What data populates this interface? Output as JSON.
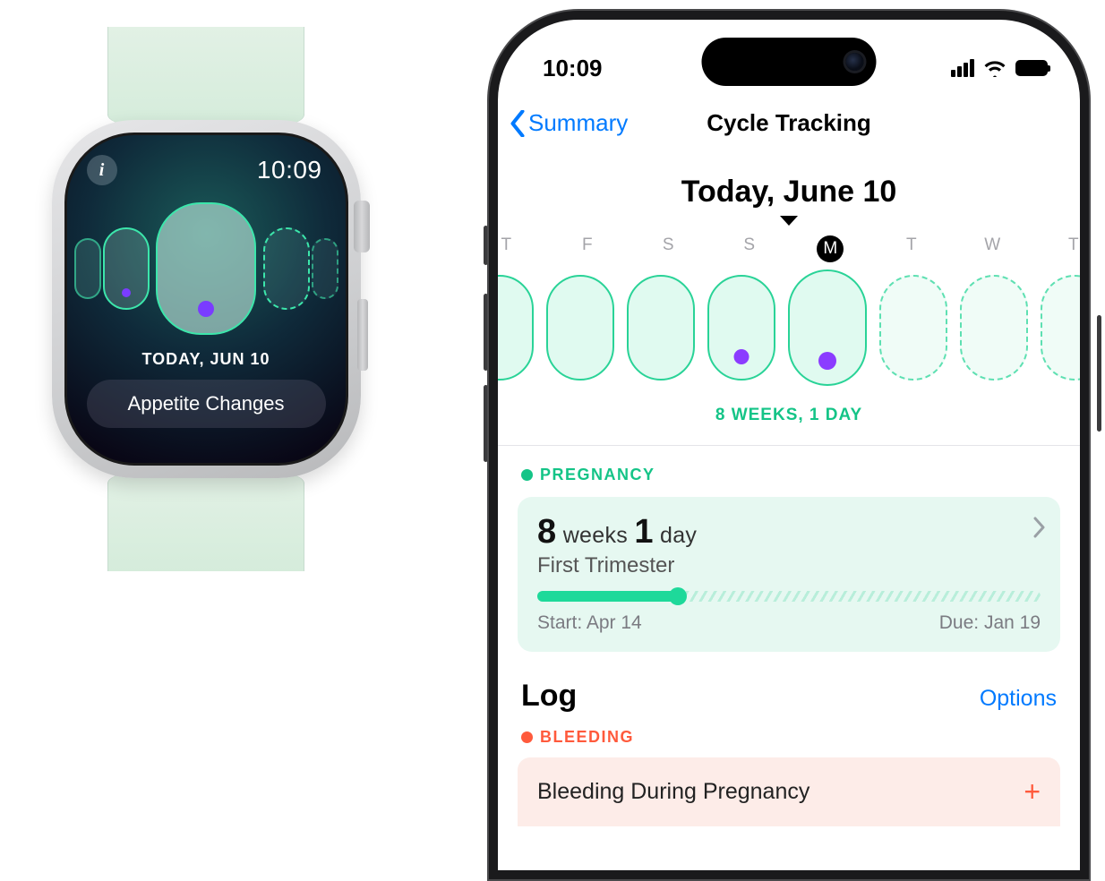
{
  "watch": {
    "time": "10:09",
    "date_label": "TODAY, JUN 10",
    "symptom_button": "Appetite Changes"
  },
  "phone": {
    "status": {
      "time": "10:09"
    },
    "nav": {
      "back_label": "Summary",
      "title": "Cycle Tracking"
    },
    "today_header": "Today, June 10",
    "days": {
      "letters": [
        "T",
        "F",
        "S",
        "S",
        "M",
        "T",
        "W",
        "T"
      ],
      "active_index": 4
    },
    "gestational_age_line": "8 WEEKS, 1 DAY",
    "pregnancy": {
      "section_label": "PREGNANCY",
      "weeks_num": "8",
      "weeks_word": "weeks",
      "days_num": "1",
      "days_word": "day",
      "trimester": "First Trimester",
      "start_label": "Start: Apr 14",
      "due_label": "Due: Jan 19",
      "progress_pct": 28
    },
    "log": {
      "title": "Log",
      "options_label": "Options",
      "bleeding_section": "BLEEDING",
      "row_label": "Bleeding During Pregnancy"
    }
  }
}
